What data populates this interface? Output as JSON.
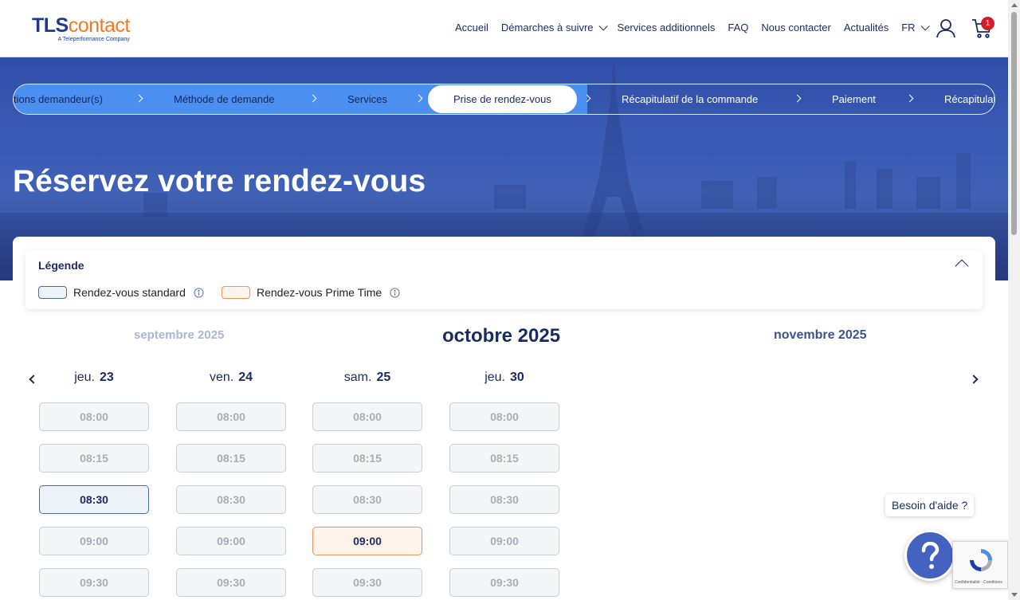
{
  "brand": {
    "name_part1": "TLS",
    "name_part2": "contact",
    "tagline": "A Teleperformance Company"
  },
  "nav": {
    "items": [
      "Accueil",
      "Démarches à suivre",
      "Services additionnels",
      "FAQ",
      "Nous contacter",
      "Actualités",
      "FR"
    ],
    "cart_count": "1"
  },
  "stepper": {
    "steps": [
      "tions demandeur(s)",
      "Méthode de demande",
      "Services",
      "Prise de rendez-vous",
      "Récapitulatif de la commande",
      "Paiement",
      "Récapitulat"
    ],
    "active": "Prise de rendez-vous"
  },
  "hero": {
    "title": "Réservez votre rendez-vous"
  },
  "legend": {
    "title": "Légende",
    "standard_label": "Rendez-vous standard",
    "prime_label": "Rendez-vous Prime Time"
  },
  "months": {
    "previous": "septembre 2025",
    "current": "octobre 2025",
    "next": "novembre 2025"
  },
  "days": [
    {
      "weekday": "jeu.",
      "date": "23",
      "slots": [
        "08:00",
        "08:15",
        "08:30",
        "09:00",
        "09:30"
      ],
      "states": [
        "off",
        "off",
        "standard",
        "off",
        "off"
      ]
    },
    {
      "weekday": "ven.",
      "date": "24",
      "slots": [
        "08:00",
        "08:15",
        "08:30",
        "09:00",
        "09:30"
      ],
      "states": [
        "off",
        "off",
        "off",
        "off",
        "off"
      ]
    },
    {
      "weekday": "sam.",
      "date": "25",
      "slots": [
        "08:00",
        "08:15",
        "08:30",
        "09:00",
        "09:30"
      ],
      "states": [
        "off",
        "off",
        "off",
        "prime",
        "off"
      ]
    },
    {
      "weekday": "jeu.",
      "date": "30",
      "slots": [
        "08:00",
        "08:15",
        "08:30",
        "09:00",
        "09:30"
      ],
      "states": [
        "off",
        "off",
        "off",
        "off",
        "off"
      ]
    }
  ],
  "help": {
    "label": "Besoin d'aide ?"
  },
  "recaptcha": {
    "text": "Confidentialité - Conditions"
  }
}
